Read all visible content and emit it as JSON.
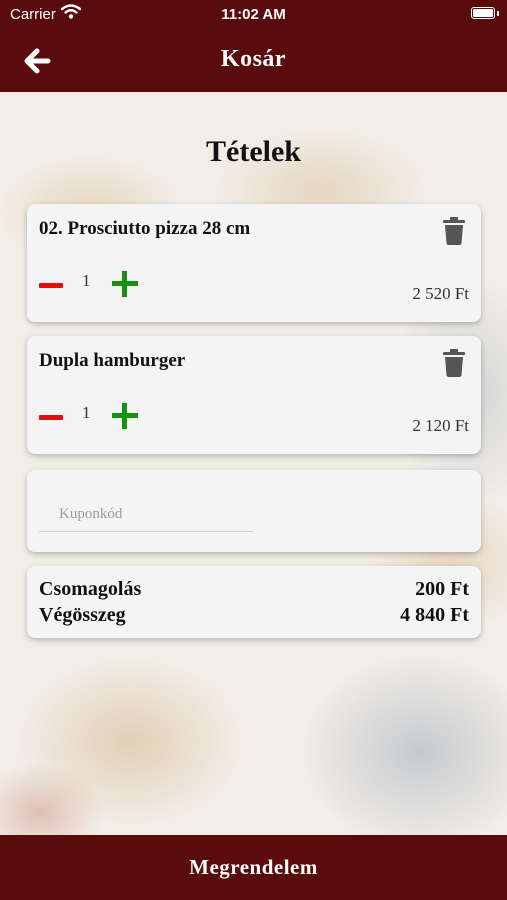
{
  "status_bar": {
    "carrier": "Carrier",
    "time": "11:02 AM"
  },
  "nav": {
    "title": "Kosár",
    "back_icon": "arrow-left-icon"
  },
  "heading": "Tételek",
  "items": [
    {
      "name": "02. Prosciutto pizza 28 cm",
      "quantity": "1",
      "price": "2 520 Ft"
    },
    {
      "name": "Dupla hamburger",
      "quantity": "1",
      "price": "2 120 Ft"
    }
  ],
  "coupon": {
    "value": "",
    "placeholder": "Kuponkód"
  },
  "summary": {
    "packaging_label": "Csomagolás",
    "packaging_value": "200 Ft",
    "total_label": "Végösszeg",
    "total_value": "4 840 Ft"
  },
  "order_button": {
    "label": "Megrendelem"
  },
  "colors": {
    "brand": "#5a0b0b",
    "minus": "#e30d0d",
    "plus": "#139113",
    "card": "#f4f4f4"
  }
}
